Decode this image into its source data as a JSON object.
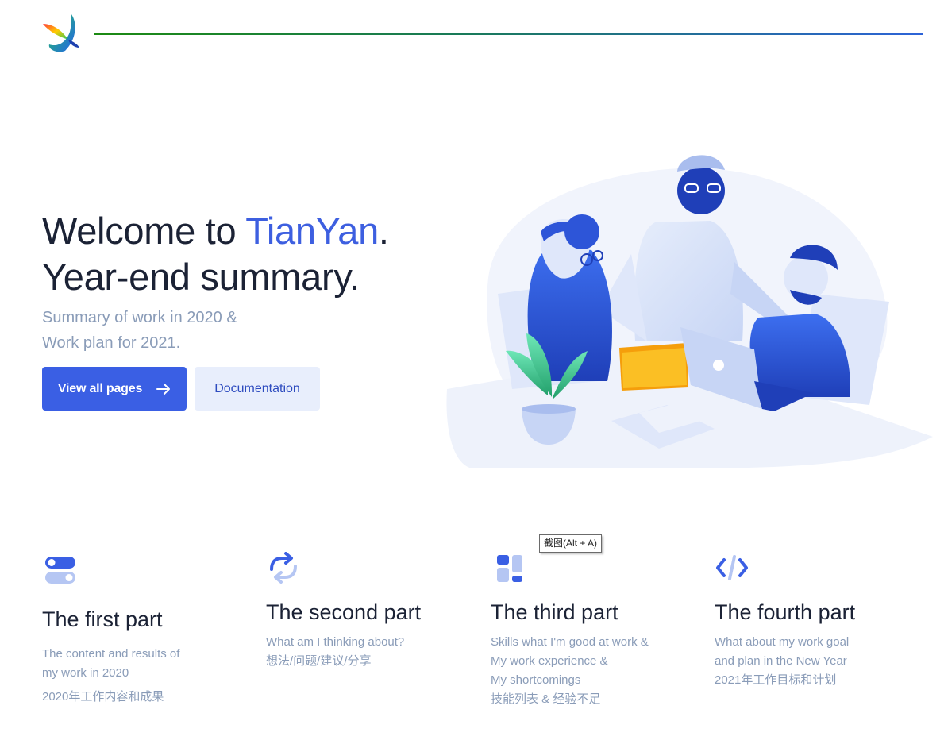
{
  "header": {
    "logo_icon": "bird-logo-icon"
  },
  "hero": {
    "title_line1_prefix": "Welcome to ",
    "title_brand": "TianYan",
    "title_line1_suffix": ".",
    "title_line2": "Year-end summary.",
    "subtitle_line1": "Summary of work in 2020 &",
    "subtitle_line2": "Work plan for 2021.",
    "primary_button": "View all pages",
    "primary_button_icon": "arrow-right-icon",
    "secondary_button": "Documentation",
    "illustration": "team-meeting-illustration"
  },
  "features": [
    {
      "icon": "toggle-switch-icon",
      "title": "The first part",
      "lines": [
        "The content and results of",
        "my work in 2020"
      ],
      "extra": "2020年工作内容和成果"
    },
    {
      "icon": "repeat-arrows-icon",
      "title": "The second part",
      "lines": [
        "What am I thinking about?",
        "想法/问题/建议/分享"
      ]
    },
    {
      "icon": "layout-blocks-icon",
      "title": "The third part",
      "lines": [
        "Skills what I'm good at work &",
        "My work experience &",
        "My shortcomings",
        "技能列表 & 经验不足"
      ]
    },
    {
      "icon": "code-brackets-icon",
      "title": "The fourth part",
      "lines": [
        "What about my work goal",
        "and plan in the New Year",
        "2021年工作目标和计划"
      ]
    }
  ],
  "tooltip": {
    "text": "截图(Alt + A)"
  },
  "colors": {
    "brand_blue": "#3a5fe4",
    "text_dark": "#1b2235",
    "text_muted": "#8a9cb8",
    "secondary_bg": "#e8eefc"
  }
}
